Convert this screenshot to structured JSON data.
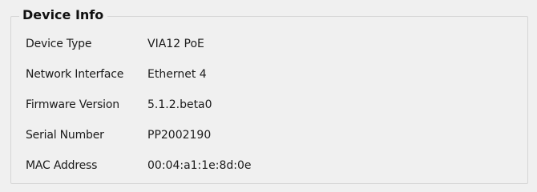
{
  "panel": {
    "title": "Device Info",
    "fields": [
      {
        "label": "Device Type",
        "value": "VIA12 PoE"
      },
      {
        "label": "Network Interface",
        "value": "Ethernet 4"
      },
      {
        "label": "Firmware Version",
        "value": "5.1.2.beta0"
      },
      {
        "label": "Serial Number",
        "value": "PP2002190"
      },
      {
        "label": "MAC Address",
        "value": "00:04:a1:1e:8d:0e"
      }
    ]
  }
}
